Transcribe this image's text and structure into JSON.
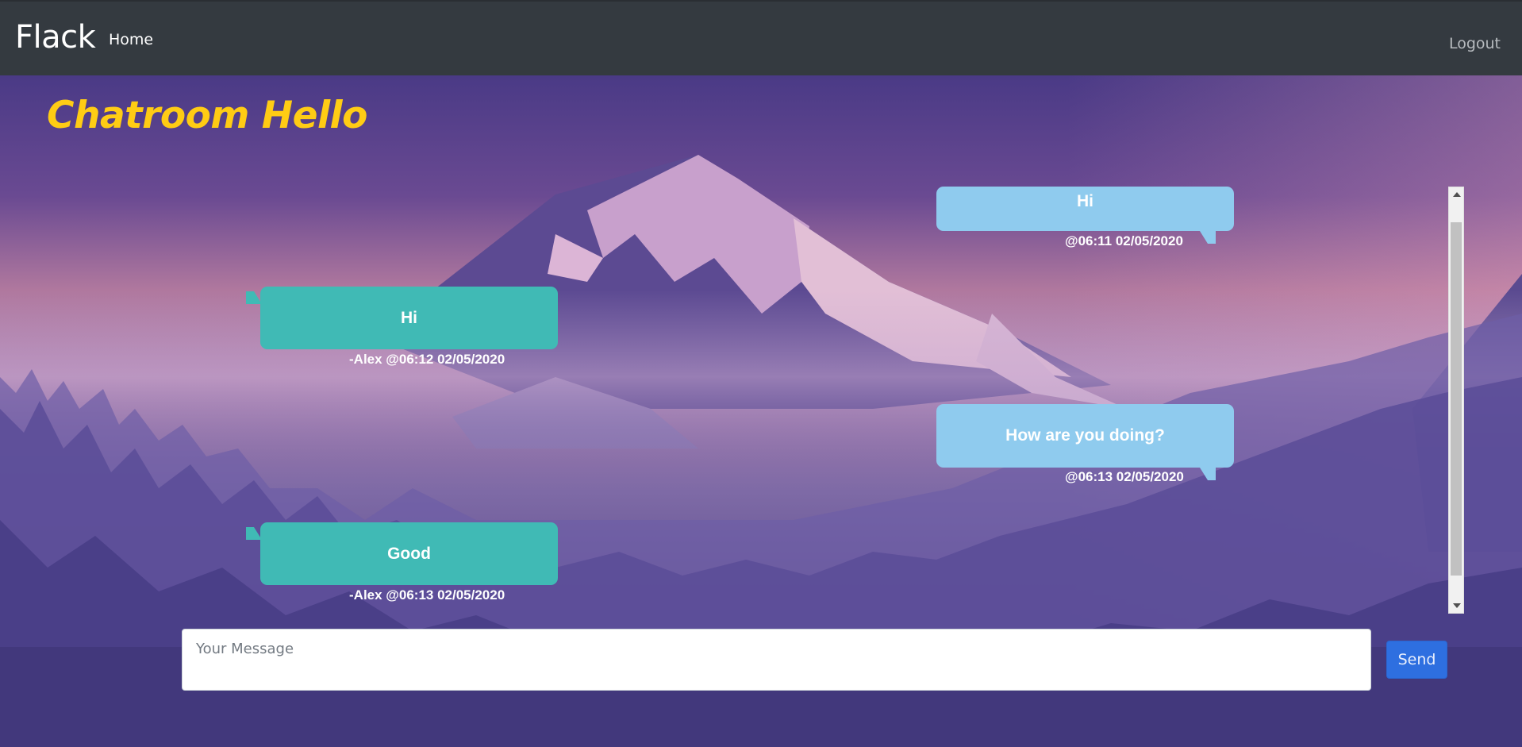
{
  "navbar": {
    "brand": "Flack",
    "home": "Home",
    "logout": "Logout"
  },
  "title": "Chatroom Hello",
  "messages": [
    {
      "side": "right",
      "text": "Hi",
      "meta": "@06:11 02/05/2020"
    },
    {
      "side": "left",
      "text": "Hi",
      "meta": "-Alex @06:12 02/05/2020"
    },
    {
      "side": "right",
      "text": "How are you doing?",
      "meta": "@06:13 02/05/2020"
    },
    {
      "side": "left",
      "text": "Good",
      "meta": "-Alex @06:13 02/05/2020"
    }
  ],
  "composer": {
    "placeholder": "Your Message",
    "value": "",
    "send_label": "Send"
  },
  "colors": {
    "navbar": "#343a40",
    "title": "#ffcc14",
    "bubble_self": "#8fcbee",
    "bubble_other": "#40bab5",
    "send": "#2e6fe0"
  }
}
